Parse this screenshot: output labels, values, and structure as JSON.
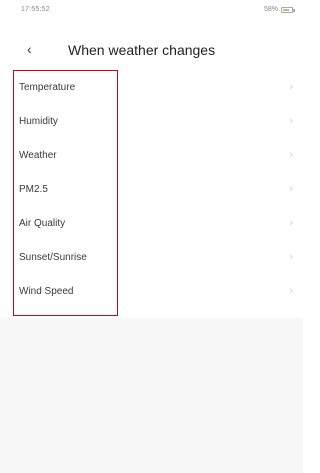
{
  "status_bar": {
    "time": "17:55:52",
    "right_text": "58%",
    "battery_level": 0.58
  },
  "header": {
    "back_icon": "‹",
    "title": "When weather changes"
  },
  "items": [
    {
      "label": "Temperature"
    },
    {
      "label": "Humidity"
    },
    {
      "label": "Weather"
    },
    {
      "label": "PM2.5"
    },
    {
      "label": "Air Quality"
    },
    {
      "label": "Sunset/Sunrise"
    },
    {
      "label": "Wind Speed"
    }
  ],
  "chevron": "›",
  "colors": {
    "highlight": "#d0021b",
    "background": "#ffffff",
    "lower_background": "#f7f7f7"
  }
}
